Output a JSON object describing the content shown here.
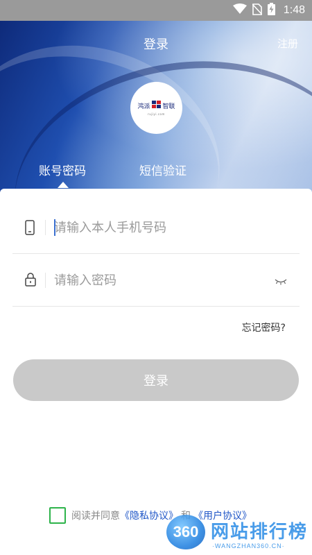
{
  "status_bar": {
    "time": "1:48"
  },
  "header": {
    "title": "登录",
    "register_label": "注册"
  },
  "logo": {
    "text_left": "鸿派",
    "text_right": "智联",
    "subtitle": "rujiyi.com"
  },
  "tabs": [
    {
      "label": "账号密码",
      "active": true
    },
    {
      "label": "短信验证",
      "active": false
    }
  ],
  "form": {
    "phone": {
      "placeholder": "请输入本人手机号码",
      "value": ""
    },
    "password": {
      "placeholder": "请输入密码",
      "value": ""
    },
    "forgot_label": "忘记密码?",
    "login_label": "登录"
  },
  "agreement": {
    "prefix": "阅读并同意",
    "privacy_label": "《隐私协议》",
    "and_label": "和",
    "user_label": "《用户协议》",
    "checked": false
  },
  "watermark": {
    "badge": "360",
    "title": "网站排行榜",
    "url": "·WANGZHAN360.CN·"
  },
  "colors": {
    "accent_blue": "#1f56c7",
    "button_disabled": "#c9c9c9",
    "checkbox_border": "#2db34a",
    "status_bar": "#9a9a9a"
  },
  "icons": {
    "status": [
      "wifi-icon",
      "no-sim-icon",
      "battery-charging-icon"
    ],
    "phone_field": "phone-icon",
    "password_field": "lock-icon",
    "password_toggle": "eye-closed-icon"
  }
}
